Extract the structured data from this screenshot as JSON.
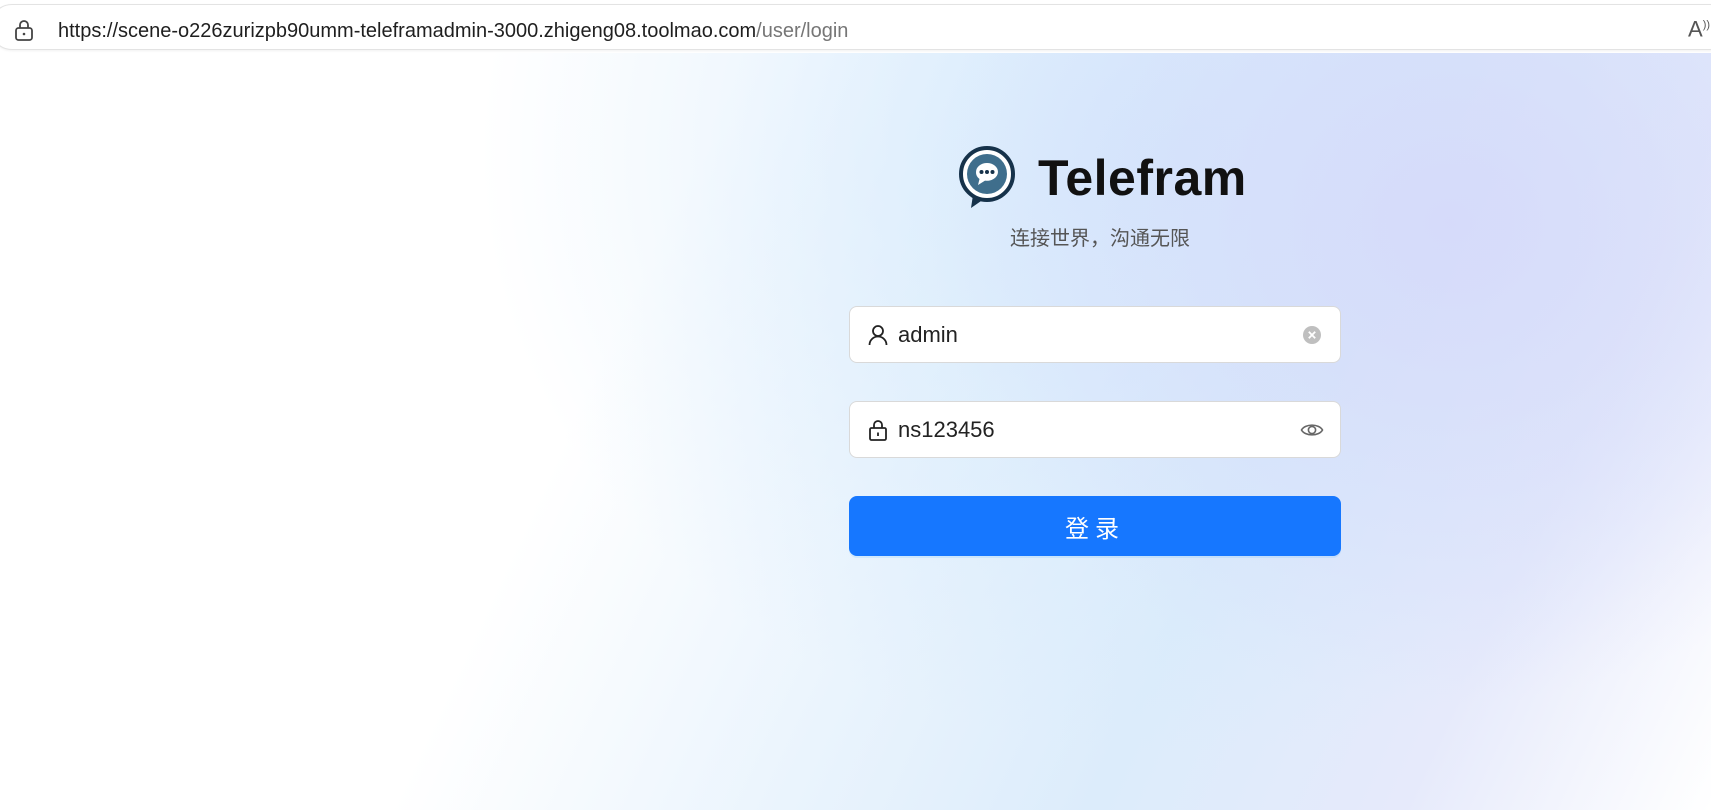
{
  "browser": {
    "url_main": "https://scene-o226zurizpb90umm-teleframadmin-3000.zhigeng08.toolmao.com",
    "url_path": "/user/login",
    "read_aloud_label": "A"
  },
  "brand": {
    "title": "Telefram",
    "tagline": "连接世界，沟通无限",
    "logo_icon": "chat-bubble-icon"
  },
  "form": {
    "username": {
      "value": "admin",
      "prefix_icon": "user-icon",
      "suffix_icon": "clear-icon"
    },
    "password": {
      "value": "ns123456",
      "prefix_icon": "lock-icon",
      "suffix_icon": "eye-icon"
    },
    "submit_label": "登录"
  },
  "colors": {
    "primary": "#1677ff"
  }
}
